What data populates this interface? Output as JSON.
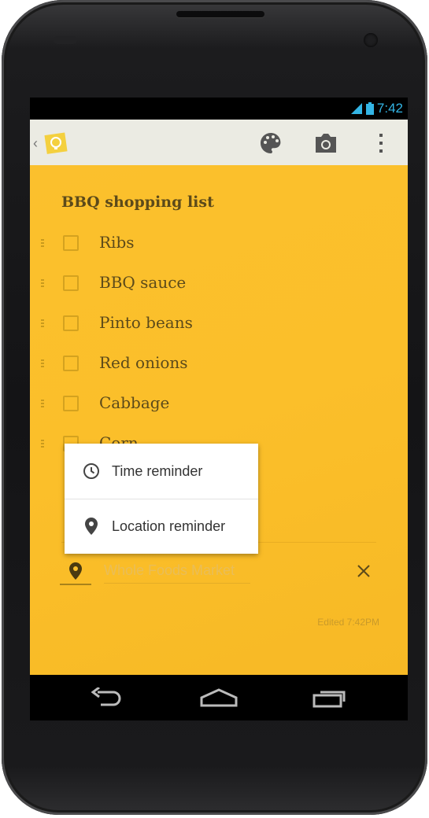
{
  "status_bar": {
    "time": "7:42"
  },
  "note": {
    "title": "BBQ shopping list",
    "items": [
      {
        "label": "Ribs"
      },
      {
        "label": "BBQ sauce"
      },
      {
        "label": "Pinto beans"
      },
      {
        "label": "Red onions"
      },
      {
        "label": "Cabbage"
      },
      {
        "label": "Corn"
      }
    ],
    "location_placeholder": "Whole Foods Market",
    "edited": "Edited 7:42PM"
  },
  "reminder_menu": {
    "options": [
      {
        "label": "Time reminder",
        "icon": "clock-icon"
      },
      {
        "label": "Location reminder",
        "icon": "location-pin-icon"
      }
    ]
  },
  "colors": {
    "note_bg": "#fbc02d",
    "status_blue": "#33b5e5",
    "action_bar": "#ebebe3"
  }
}
